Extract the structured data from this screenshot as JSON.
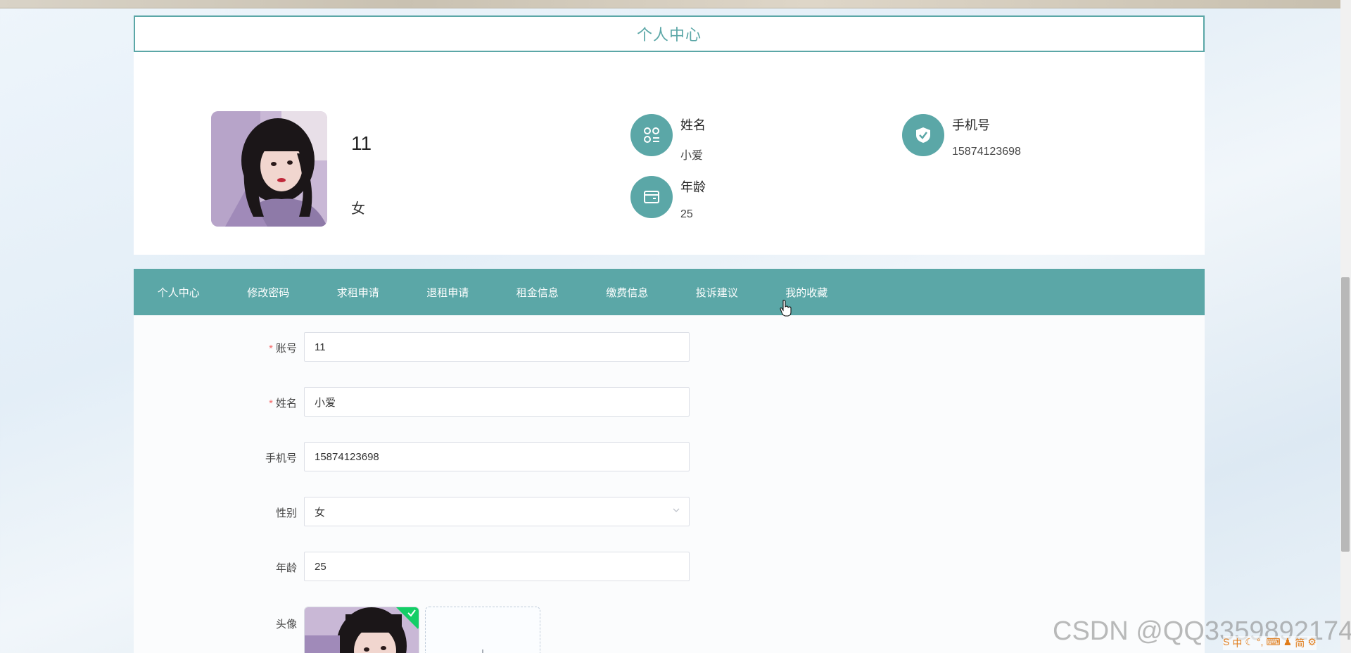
{
  "header": {
    "title": "个人中心"
  },
  "profile": {
    "username": "11",
    "gender": "女",
    "fields": [
      {
        "label": "姓名",
        "value": "小爱",
        "icon": "apps-grid-icon"
      },
      {
        "label": "手机号",
        "value": "15874123698",
        "icon": "shield-check-icon"
      },
      {
        "label": "年龄",
        "value": "25",
        "icon": "wallet-icon"
      }
    ]
  },
  "tabs": [
    {
      "label": "个人中心"
    },
    {
      "label": "修改密码"
    },
    {
      "label": "求租申请"
    },
    {
      "label": "退租申请"
    },
    {
      "label": "租金信息"
    },
    {
      "label": "缴费信息"
    },
    {
      "label": "投诉建议"
    },
    {
      "label": "我的收藏"
    }
  ],
  "form": {
    "account": {
      "label": "账号",
      "value": "11",
      "required": true
    },
    "name": {
      "label": "姓名",
      "value": "小爱",
      "required": true
    },
    "phone": {
      "label": "手机号",
      "value": "15874123698",
      "required": false
    },
    "gender": {
      "label": "性别",
      "value": "女",
      "required": false
    },
    "age": {
      "label": "年龄",
      "value": "25",
      "required": false
    },
    "avatar": {
      "label": "头像"
    }
  },
  "watermark": "CSDN @QQ3359892174",
  "ime": {
    "items": [
      "S",
      "中",
      "☾",
      "°,",
      "⌨",
      "♟",
      "简",
      "⚙"
    ]
  },
  "colors": {
    "accent": "#5ba7a7",
    "required": "#f56c6c",
    "success": "#13ce66"
  }
}
